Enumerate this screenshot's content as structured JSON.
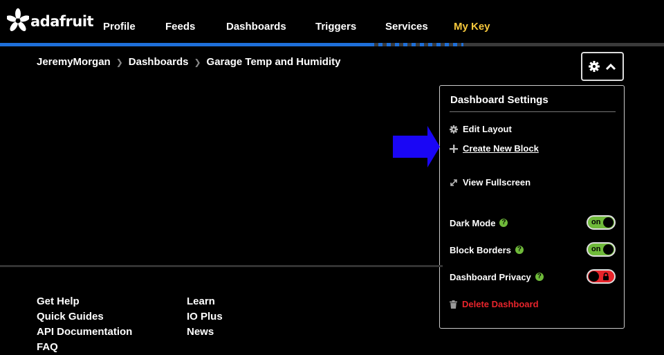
{
  "header": {
    "logo_text": "adafruit",
    "nav": [
      {
        "label": "Profile",
        "active": false
      },
      {
        "label": "Feeds",
        "active": false
      },
      {
        "label": "Dashboards",
        "active": false
      },
      {
        "label": "Triggers",
        "active": false
      },
      {
        "label": "Services",
        "active": false
      },
      {
        "label": "My Key",
        "active": true
      }
    ]
  },
  "breadcrumb": [
    "JeremyMorgan",
    "Dashboards",
    "Garage Temp and Humidity"
  ],
  "settings_menu": {
    "title": "Dashboard Settings",
    "actions": [
      {
        "label": "Edit Layout",
        "icon": "gear-icon"
      },
      {
        "label": "Create New Block",
        "icon": "plus-icon"
      },
      {
        "label": "View Fullscreen",
        "icon": "expand-icon"
      }
    ],
    "toggles": [
      {
        "label": "Dark Mode",
        "state": "on"
      },
      {
        "label": "Block Borders",
        "state": "on"
      },
      {
        "label": "Dashboard Privacy",
        "state": "locked"
      }
    ],
    "delete_label": "Delete Dashboard"
  },
  "footer": {
    "col1": [
      "Get Help",
      "Quick Guides",
      "API Documentation",
      "FAQ"
    ],
    "col2": [
      "Learn",
      "IO Plus",
      "News"
    ]
  },
  "colors": {
    "accent_blue": "#1e6fd9",
    "mykey_yellow": "#f8c93c",
    "toggle_on": "#6fba3a",
    "danger_red": "#e8242b",
    "annotation_arrow": "#1a06f5"
  }
}
